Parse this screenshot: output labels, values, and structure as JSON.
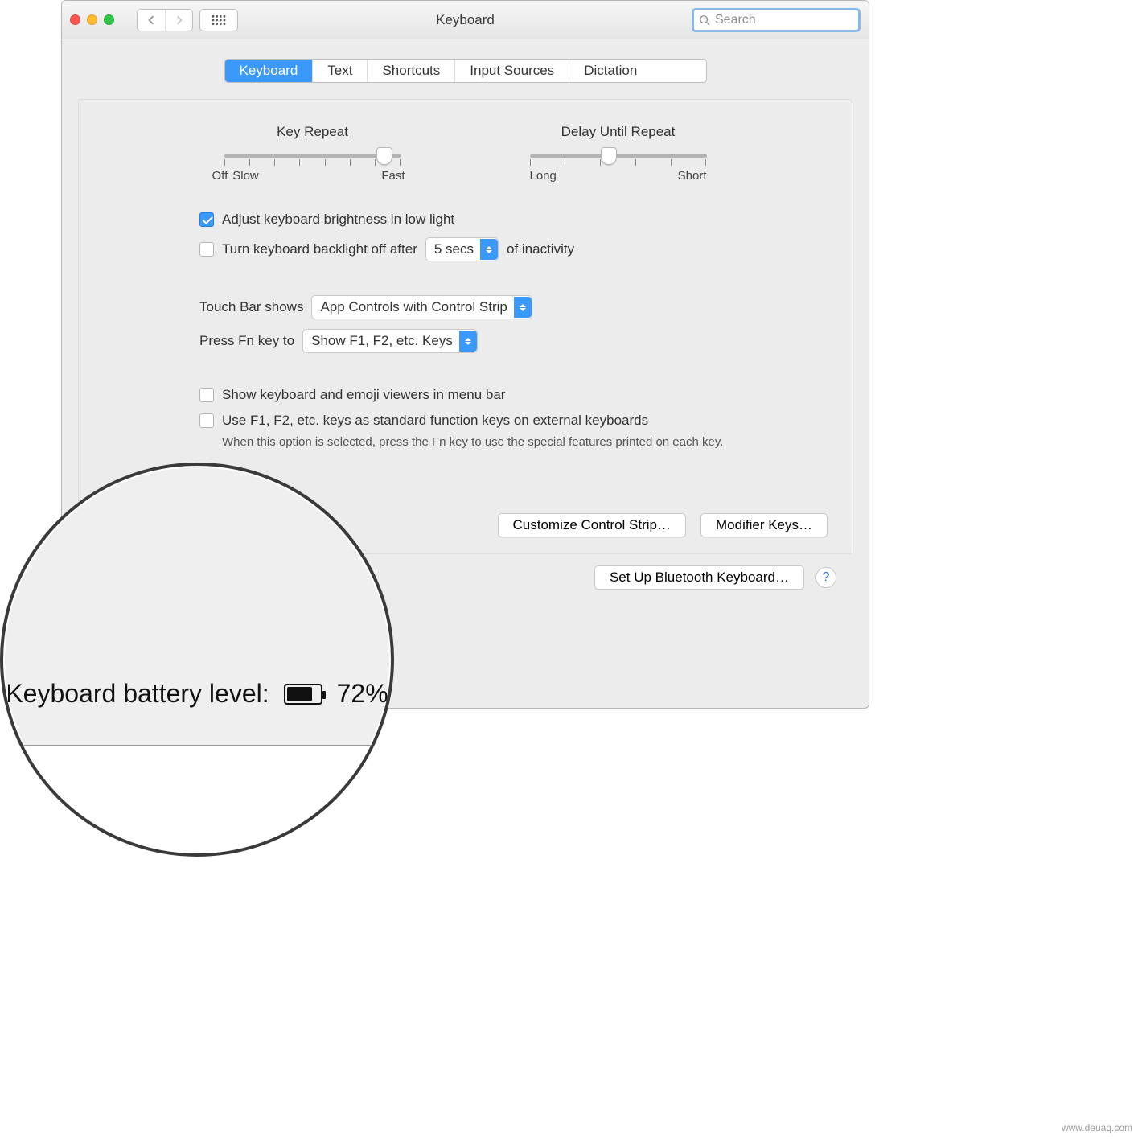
{
  "titlebar": {
    "title": "Keyboard"
  },
  "search": {
    "placeholder": "Search"
  },
  "tabs": [
    {
      "label": "Keyboard",
      "active": true
    },
    {
      "label": "Text"
    },
    {
      "label": "Shortcuts"
    },
    {
      "label": "Input Sources"
    },
    {
      "label": "Dictation"
    }
  ],
  "sliders": {
    "key_repeat": {
      "label": "Key Repeat",
      "left": "Off",
      "left2": "Slow",
      "right": "Fast",
      "ticks": 8,
      "pos": 0.86
    },
    "delay": {
      "label": "Delay Until Repeat",
      "left": "Long",
      "right": "Short",
      "ticks": 6,
      "pos": 0.4
    }
  },
  "options": {
    "adjust_brightness": {
      "label": "Adjust keyboard brightness in low light",
      "checked": true
    },
    "backlight_off": {
      "prefix": "Turn keyboard backlight off after",
      "value": "5 secs",
      "suffix": "of inactivity",
      "checked": false
    },
    "touch_bar": {
      "prefix": "Touch Bar shows",
      "value": "App Controls with Control Strip"
    },
    "fn_key": {
      "prefix": "Press Fn key to",
      "value": "Show F1, F2, etc. Keys"
    },
    "show_viewers": {
      "label": "Show keyboard and emoji viewers in menu bar",
      "checked": false
    },
    "use_fn": {
      "label": "Use F1, F2, etc. keys as standard function keys on external keyboards",
      "help": "When this option is selected, press the Fn key to use the special features printed on each key.",
      "checked": false
    }
  },
  "footer": {
    "customize": "Customize Control Strip…",
    "modifier": "Modifier Keys…",
    "setup_bt": "Set Up Bluetooth Keyboard…",
    "help": "?"
  },
  "battery": {
    "label": "Keyboard battery level:",
    "pct": "72%"
  },
  "watermark": "www.deuaq.com"
}
